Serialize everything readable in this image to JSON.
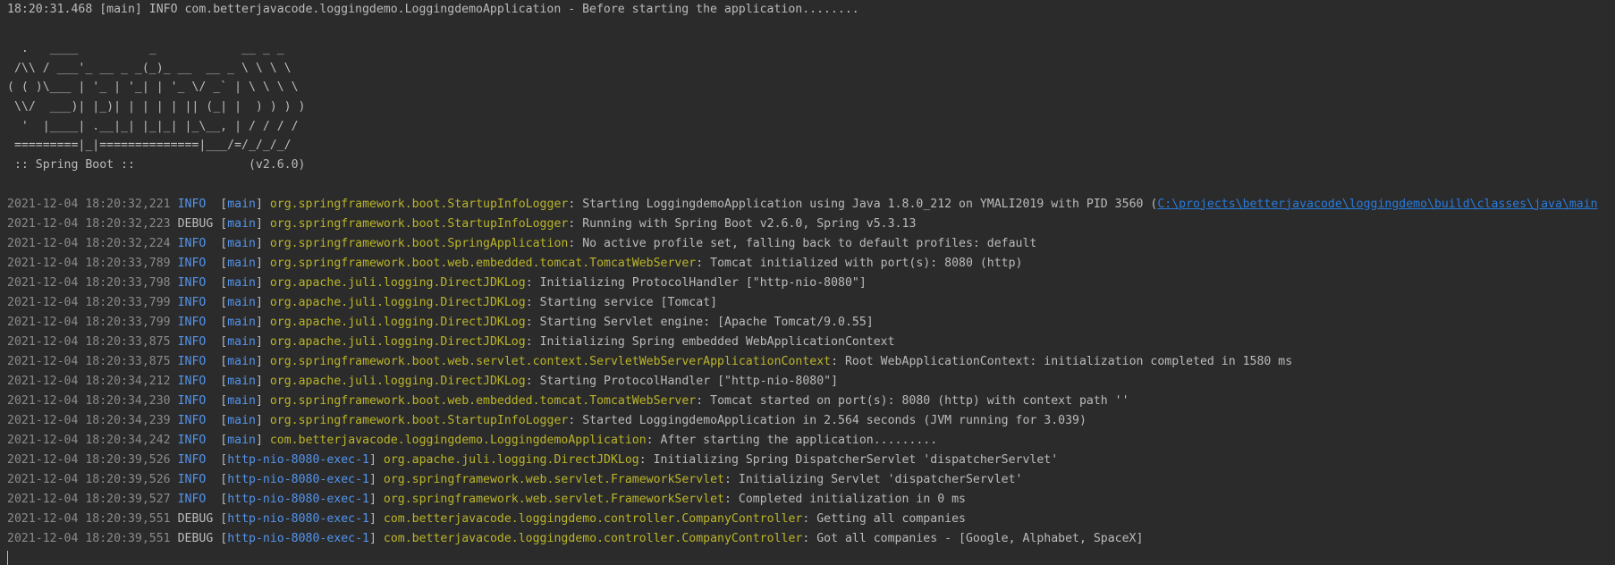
{
  "console": {
    "header_line": "18:20:31.468 [main] INFO com.betterjavacode.loggingdemo.LoggingdemoApplication - Before starting the application........",
    "banner": [
      "  .   ____          _            __ _ _",
      " /\\\\ / ___'_ __ _ _(_)_ __  __ _ \\ \\ \\ \\",
      "( ( )\\___ | '_ | '_| | '_ \\/ _` | \\ \\ \\ \\",
      " \\\\/  ___)| |_)| | | | | || (_| |  ) ) ) )",
      "  '  |____| .__|_| |_|_| |_\\__, | / / / /",
      " =========|_|==============|___/=/_/_/_/",
      " :: Spring Boot ::                (v2.6.0)"
    ],
    "logs": [
      {
        "ts": "2021-12-04 18:20:32,221",
        "level": "INFO ",
        "thread": "main",
        "logger": "org.springframework.boot.StartupInfoLogger",
        "message": "Starting LoggingdemoApplication using Java 1.8.0_212 on YMALI2019 with PID 3560 (",
        "link": "C:\\projects\\betterjavacode\\loggingdemo\\build\\classes\\java\\main"
      },
      {
        "ts": "2021-12-04 18:20:32,223",
        "level": "DEBUG",
        "thread": "main",
        "logger": "org.springframework.boot.StartupInfoLogger",
        "message": "Running with Spring Boot v2.6.0, Spring v5.3.13"
      },
      {
        "ts": "2021-12-04 18:20:32,224",
        "level": "INFO ",
        "thread": "main",
        "logger": "org.springframework.boot.SpringApplication",
        "message": "No active profile set, falling back to default profiles: default"
      },
      {
        "ts": "2021-12-04 18:20:33,789",
        "level": "INFO ",
        "thread": "main",
        "logger": "org.springframework.boot.web.embedded.tomcat.TomcatWebServer",
        "message": "Tomcat initialized with port(s): 8080 (http)"
      },
      {
        "ts": "2021-12-04 18:20:33,798",
        "level": "INFO ",
        "thread": "main",
        "logger": "org.apache.juli.logging.DirectJDKLog",
        "message": "Initializing ProtocolHandler [\"http-nio-8080\"]"
      },
      {
        "ts": "2021-12-04 18:20:33,799",
        "level": "INFO ",
        "thread": "main",
        "logger": "org.apache.juli.logging.DirectJDKLog",
        "message": "Starting service [Tomcat]"
      },
      {
        "ts": "2021-12-04 18:20:33,799",
        "level": "INFO ",
        "thread": "main",
        "logger": "org.apache.juli.logging.DirectJDKLog",
        "message": "Starting Servlet engine: [Apache Tomcat/9.0.55]"
      },
      {
        "ts": "2021-12-04 18:20:33,875",
        "level": "INFO ",
        "thread": "main",
        "logger": "org.apache.juli.logging.DirectJDKLog",
        "message": "Initializing Spring embedded WebApplicationContext"
      },
      {
        "ts": "2021-12-04 18:20:33,875",
        "level": "INFO ",
        "thread": "main",
        "logger": "org.springframework.boot.web.servlet.context.ServletWebServerApplicationContext",
        "message": "Root WebApplicationContext: initialization completed in 1580 ms"
      },
      {
        "ts": "2021-12-04 18:20:34,212",
        "level": "INFO ",
        "thread": "main",
        "logger": "org.apache.juli.logging.DirectJDKLog",
        "message": "Starting ProtocolHandler [\"http-nio-8080\"]"
      },
      {
        "ts": "2021-12-04 18:20:34,230",
        "level": "INFO ",
        "thread": "main",
        "logger": "org.springframework.boot.web.embedded.tomcat.TomcatWebServer",
        "message": "Tomcat started on port(s): 8080 (http) with context path ''"
      },
      {
        "ts": "2021-12-04 18:20:34,239",
        "level": "INFO ",
        "thread": "main",
        "logger": "org.springframework.boot.StartupInfoLogger",
        "message": "Started LoggingdemoApplication in 2.564 seconds (JVM running for 3.039)"
      },
      {
        "ts": "2021-12-04 18:20:34,242",
        "level": "INFO ",
        "thread": "main",
        "logger": "com.betterjavacode.loggingdemo.LoggingdemoApplication",
        "message": "After starting the application........."
      },
      {
        "ts": "2021-12-04 18:20:39,526",
        "level": "INFO ",
        "thread": "http-nio-8080-exec-1",
        "logger": "org.apache.juli.logging.DirectJDKLog",
        "message": "Initializing Spring DispatcherServlet 'dispatcherServlet'"
      },
      {
        "ts": "2021-12-04 18:20:39,526",
        "level": "INFO ",
        "thread": "http-nio-8080-exec-1",
        "logger": "org.springframework.web.servlet.FrameworkServlet",
        "message": "Initializing Servlet 'dispatcherServlet'"
      },
      {
        "ts": "2021-12-04 18:20:39,527",
        "level": "INFO ",
        "thread": "http-nio-8080-exec-1",
        "logger": "org.springframework.web.servlet.FrameworkServlet",
        "message": "Completed initialization in 0 ms"
      },
      {
        "ts": "2021-12-04 18:20:39,551",
        "level": "DEBUG",
        "thread": "http-nio-8080-exec-1",
        "logger": "com.betterjavacode.loggingdemo.controller.CompanyController",
        "message": "Getting all companies"
      },
      {
        "ts": "2021-12-04 18:20:39,551",
        "level": "DEBUG",
        "thread": "http-nio-8080-exec-1",
        "logger": "com.betterjavacode.loggingdemo.controller.CompanyController",
        "message": "Got all companies - [Google, Alphabet, SpaceX]"
      }
    ]
  },
  "colors": {
    "background": "#2b2b2b",
    "text": "#bbbbbb",
    "timestamp": "#8a8a8a",
    "info_level": "#5394ec",
    "thread": "#5394ec",
    "logger": "#bbb529",
    "link": "#287bde"
  }
}
